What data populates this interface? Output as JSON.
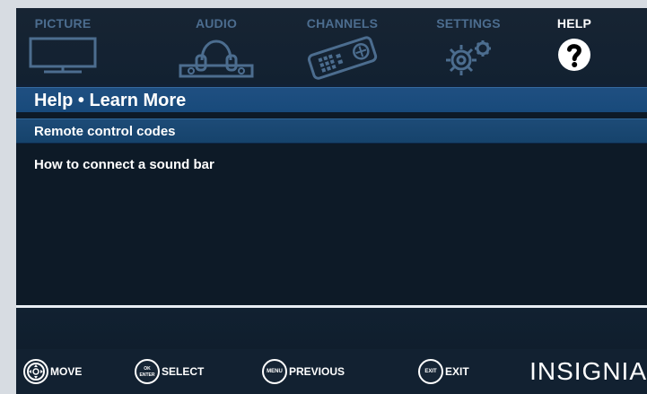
{
  "tabs": {
    "picture": {
      "label": "PICTURE"
    },
    "audio": {
      "label": "AUDIO"
    },
    "channels": {
      "label": "CHANNELS"
    },
    "settings": {
      "label": "SETTINGS"
    },
    "help": {
      "label": "HELP"
    }
  },
  "title": "Help • Learn More",
  "menu": {
    "items": [
      {
        "label": "Remote control codes"
      },
      {
        "label": "How to connect a sound bar"
      }
    ]
  },
  "footer": {
    "move": "MOVE",
    "select": "SELECT",
    "previous": "PREVIOUS",
    "exit": "EXIT",
    "ok_top": "OK",
    "ok_bottom": "ENTER",
    "menu_button": "MENU",
    "exit_button": "EXIT",
    "brand": "INSIGNIA"
  },
  "colors": {
    "background": "#122131",
    "accent_blue": "#1d4b77",
    "inactive_text": "#4c6d8f",
    "active_text": "#ffffff"
  }
}
